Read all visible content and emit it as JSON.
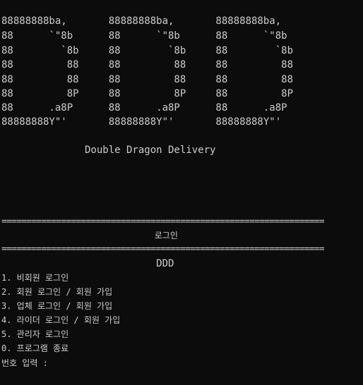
{
  "console": {
    "banner": [
      "88888888ba,       88888888ba,       88888888ba,",
      "88      `\"8b      88      `\"8b      88      `\"8b",
      "88        `8b     88        `8b     88        `8b",
      "88         88     88         88     88         88",
      "88         88     88         88     88         88",
      "88         8P     88         8P     88         8P",
      "88      .a8P      88      .a8P      88      .a8P",
      "88888888Y\"'       88888888Y\"'       88888888Y\"'"
    ],
    "banner_title": "              Double Dragon Delivery",
    "separator_1": "=================================================================",
    "login_heading": "                              로그인",
    "separator_2": "=================================================================",
    "ddd_heading": "                          DDD",
    "menu": [
      "1. 비회원 로그인",
      "2. 회원 로그인 / 회원 가입",
      "3. 업체 로그인 / 회원 가입",
      "4. 라이더 로그인 / 회원 가입",
      "5. 관리자 로그인",
      "0. 프로그램 종료"
    ],
    "prompt": "번호 입력 :"
  }
}
